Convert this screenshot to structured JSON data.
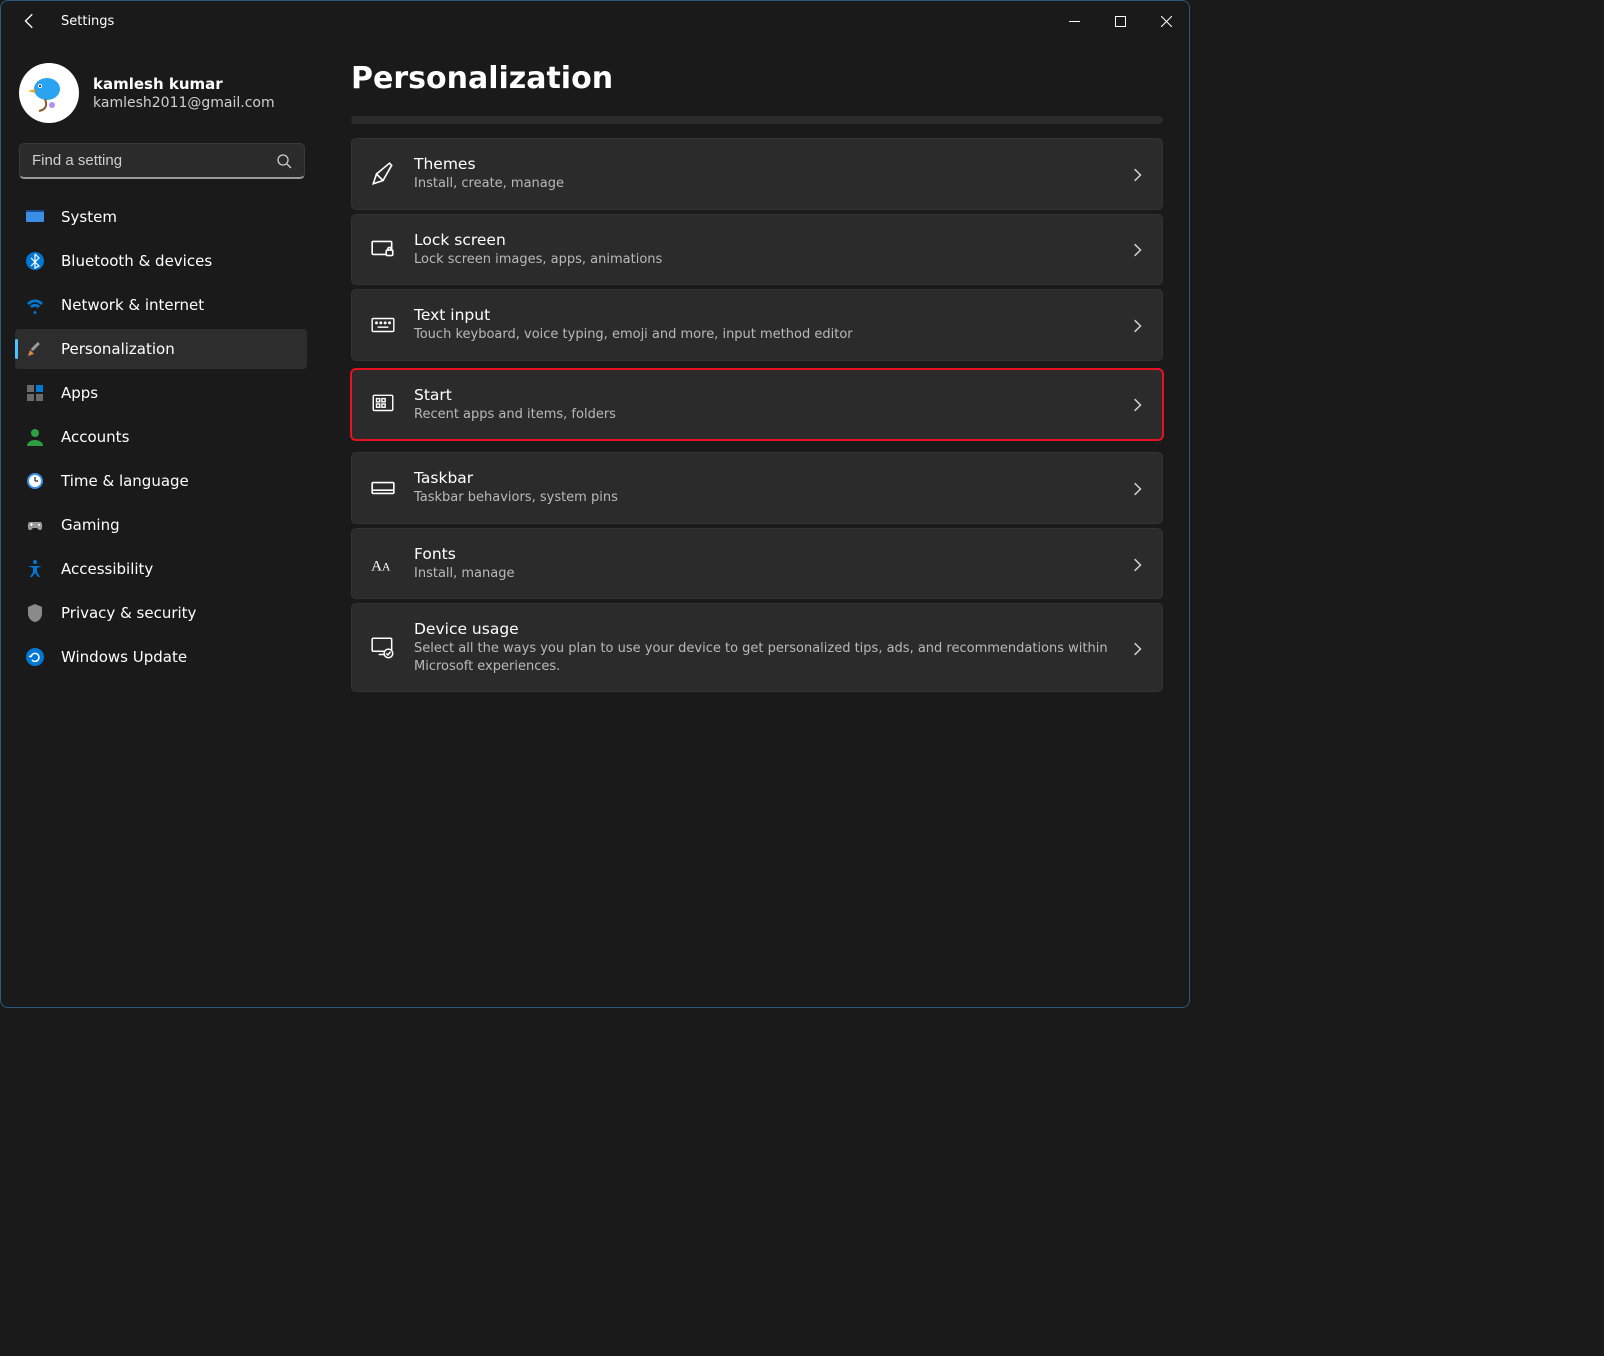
{
  "window": {
    "title": "Settings"
  },
  "profile": {
    "name": "kamlesh kumar",
    "email": "kamlesh2011@gmail.com"
  },
  "search": {
    "placeholder": "Find a setting"
  },
  "sidebar": {
    "items": [
      {
        "label": "System",
        "icon": "monitor-icon"
      },
      {
        "label": "Bluetooth & devices",
        "icon": "bluetooth-icon"
      },
      {
        "label": "Network & internet",
        "icon": "wifi-icon"
      },
      {
        "label": "Personalization",
        "icon": "paintbrush-icon",
        "active": true
      },
      {
        "label": "Apps",
        "icon": "apps-icon"
      },
      {
        "label": "Accounts",
        "icon": "person-icon"
      },
      {
        "label": "Time & language",
        "icon": "clock-icon"
      },
      {
        "label": "Gaming",
        "icon": "gamepad-icon"
      },
      {
        "label": "Accessibility",
        "icon": "accessibility-icon"
      },
      {
        "label": "Privacy & security",
        "icon": "shield-icon"
      },
      {
        "label": "Windows Update",
        "icon": "update-icon"
      }
    ]
  },
  "page": {
    "title": "Personalization",
    "cards": [
      {
        "title": "Themes",
        "desc": "Install, create, manage",
        "icon": "pen-icon"
      },
      {
        "title": "Lock screen",
        "desc": "Lock screen images, apps, animations",
        "icon": "lock-screen-icon"
      },
      {
        "title": "Text input",
        "desc": "Touch keyboard, voice typing, emoji and more, input method editor",
        "icon": "keyboard-icon"
      },
      {
        "title": "Start",
        "desc": "Recent apps and items, folders",
        "icon": "start-icon",
        "highlighted": true
      },
      {
        "title": "Taskbar",
        "desc": "Taskbar behaviors, system pins",
        "icon": "taskbar-icon"
      },
      {
        "title": "Fonts",
        "desc": "Install, manage",
        "icon": "fonts-icon"
      },
      {
        "title": "Device usage",
        "desc": "Select all the ways you plan to use your device to get personalized tips, ads, and recommendations within Microsoft experiences.",
        "icon": "device-usage-icon"
      }
    ]
  }
}
